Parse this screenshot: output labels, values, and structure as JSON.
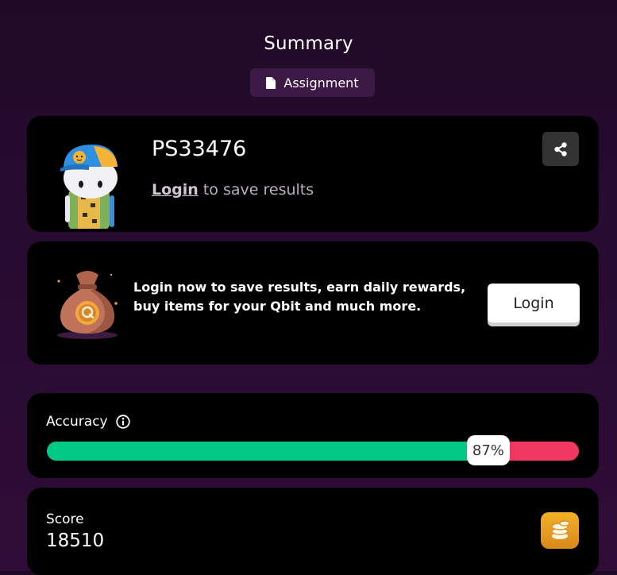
{
  "header": {
    "title": "Summary",
    "type_badge": "Assignment"
  },
  "profile": {
    "username": "PS33476",
    "login_link": "Login",
    "login_suffix": " to save results"
  },
  "promo": {
    "text_line1": "Login now to save results, earn daily rewards,",
    "text_line2": "buy items for your Qbit and much more.",
    "login_button": "Login"
  },
  "accuracy": {
    "label": "Accuracy",
    "percent": 87,
    "percent_label": "87%"
  },
  "score": {
    "label": "Score",
    "value": "18510"
  },
  "colors": {
    "correct": "#00c985",
    "incorrect": "#f0375f",
    "coin": "#f3b128"
  },
  "icons": {
    "type_badge": "document-icon",
    "share": "share-icon",
    "accuracy_info": "info-icon",
    "score": "coins-icon"
  }
}
